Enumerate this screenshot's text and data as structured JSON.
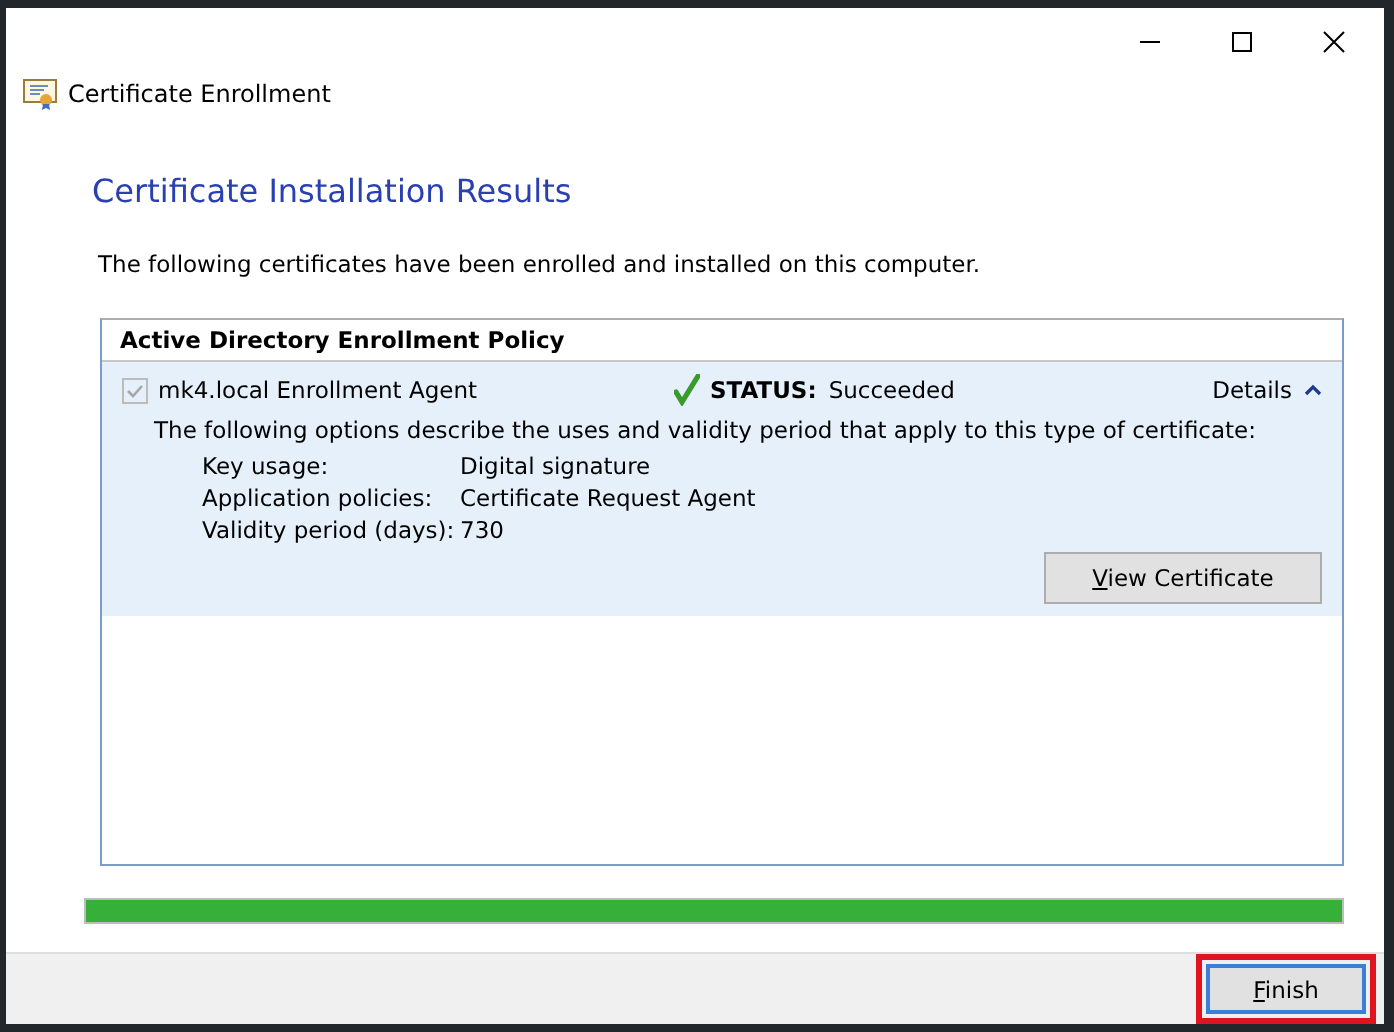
{
  "window": {
    "title": "Certificate Enrollment"
  },
  "page": {
    "heading": "Certificate Installation Results",
    "description": "The following certificates have been enrolled and installed on this computer."
  },
  "policy": {
    "name": "Active Directory Enrollment Policy",
    "certificates": [
      {
        "name": "mk4.local Enrollment Agent",
        "checked": true,
        "disabled": true,
        "status_label": "STATUS:",
        "status": "Succeeded",
        "details_label": "Details",
        "expanded": true,
        "intro": "The following options describe the uses and validity period that apply to this type of certificate:",
        "properties": [
          {
            "label": "Key usage:",
            "value": "Digital signature"
          },
          {
            "label": "Application policies:",
            "value": "Certificate Request Agent"
          },
          {
            "label": "Validity period (days):",
            "value": "730"
          }
        ],
        "view_button": "View Certificate"
      }
    ]
  },
  "progress": {
    "level": 1
  },
  "buttons": [
    {
      "label": "Finish",
      "highlighted": true
    }
  ]
}
